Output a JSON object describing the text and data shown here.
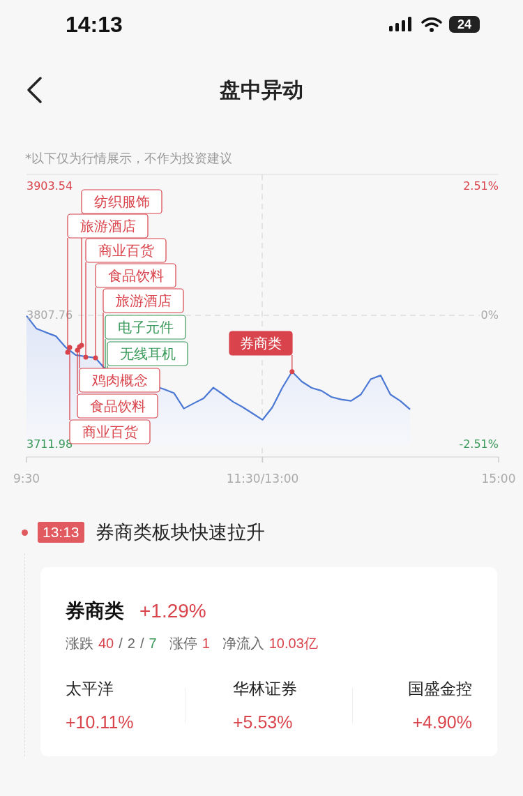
{
  "status_bar": {
    "time": "14:13",
    "battery": "24"
  },
  "nav": {
    "title": "盘中异动"
  },
  "disclaimer": "*以下仅为行情展示，不作为投资建议",
  "chart_data": {
    "type": "area",
    "grid": true,
    "categories": [
      "9:30",
      null,
      null,
      null,
      null,
      null,
      null,
      null,
      null,
      null,
      null,
      null,
      null,
      null,
      null,
      null,
      null,
      null,
      null,
      null,
      null,
      null,
      null,
      null,
      "11:30/13:00",
      null,
      null,
      null,
      null,
      null,
      null,
      null,
      null,
      null,
      null,
      null,
      null,
      null,
      null,
      null,
      null,
      null,
      null,
      null,
      null,
      null,
      null,
      null,
      "15:00"
    ],
    "series": [
      {
        "color": "#4a78d4",
        "values": [
          3807.4,
          3798.0,
          3795.0,
          3792.3,
          3784.0,
          3778.3,
          3777.2,
          3776.3,
          3767.9,
          null,
          null,
          null,
          null,
          null,
          3752.9,
          3750.0,
          3738.6,
          3742.5,
          3746.2,
          3754.1,
          3749.0,
          3743.6,
          3739.6,
          3734.9,
          3730.2,
          3739.6,
          3753.9,
          3766.0,
          3758.6,
          3753.9,
          3751.8,
          3747.2,
          3745.3,
          3744.3,
          3749.0,
          3760.4,
          3763.2,
          3749.0,
          3744.3,
          3737.9,
          null,
          null,
          null,
          null,
          null,
          null,
          null,
          null,
          null
        ]
      }
    ],
    "ylim": [
      3711.98,
      3903.54
    ],
    "yticks": [
      {
        "value": 3903.54,
        "label": "3903.54"
      },
      {
        "value": 3807.76,
        "label": "3807.76"
      },
      {
        "value": 3711.98,
        "label": "3711.98"
      }
    ]
  },
  "chart_callouts": [
    {
      "text": "纺织服饰",
      "kind": "up"
    },
    {
      "text": "旅游酒店",
      "kind": "up"
    },
    {
      "text": "商业百货",
      "kind": "up"
    },
    {
      "text": "食品饮料",
      "kind": "up"
    },
    {
      "text": "旅游酒店",
      "kind": "up"
    },
    {
      "text": "电子元件",
      "kind": "down"
    },
    {
      "text": "无线耳机",
      "kind": "down"
    },
    {
      "text": "券商类",
      "kind": "highlight"
    },
    {
      "text": "鸡肉概念",
      "kind": "up"
    },
    {
      "text": "食品饮料",
      "kind": "up"
    },
    {
      "text": "商业百货",
      "kind": "up"
    }
  ],
  "right_axis": [
    "2.51%",
    "0%",
    "-2.51%"
  ],
  "event": {
    "time": "13:13",
    "headline": "券商类板块快速拉升",
    "sector": {
      "name": "券商类",
      "change": "+1.29%",
      "stats": [
        {
          "label": "涨跌",
          "segments": [
            {
              "text": "40",
              "kind": "up"
            },
            {
              "text": "/",
              "kind": "sep"
            },
            {
              "text": "2",
              "kind": "flat"
            },
            {
              "text": "/",
              "kind": "sep"
            },
            {
              "text": "7",
              "kind": "down"
            }
          ]
        },
        {
          "label": "涨停",
          "segments": [
            {
              "text": "1",
              "kind": "up"
            }
          ]
        },
        {
          "label": "净流入",
          "segments": [
            {
              "text": "10.03亿",
              "kind": "up"
            }
          ]
        }
      ]
    },
    "stocks": [
      {
        "name": "太平洋",
        "change": "+10.11%",
        "kind": "up"
      },
      {
        "name": "华林证券",
        "change": "+5.53%",
        "kind": "up"
      },
      {
        "name": "国盛金控",
        "change": "+4.90%",
        "kind": "up"
      }
    ]
  }
}
